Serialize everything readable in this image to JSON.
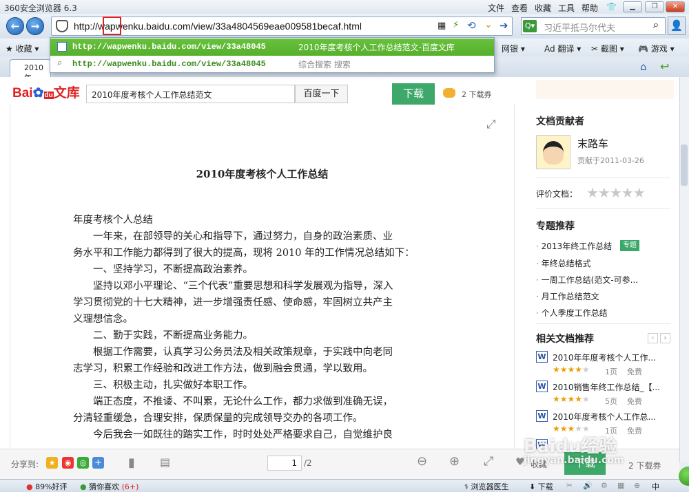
{
  "browser": {
    "title": "360安全浏览器 6.3",
    "menu": [
      "文件",
      "查看",
      "收藏",
      "工具",
      "帮助"
    ],
    "address": "http://wapwenku.baidu.com/view/33a4804569eae009581becaf.html",
    "search_placeholder": "习近平抵马尔代夫",
    "bookmarks": [
      "收藏",
      "网银",
      "翻译",
      "截图",
      "游戏"
    ],
    "tab_label": "2010年"
  },
  "dropdown": {
    "rows": [
      {
        "url": "http://wapwenku.baidu.com/view/33a48045",
        "title": "2010年度考核个人工作总结范文-百度文库"
      },
      {
        "url": "http://wapwenku.baidu.com/view/33a48045",
        "title": "综合搜索 搜索"
      }
    ]
  },
  "baidu": {
    "logo_text": "Bai",
    "logo_du": "du",
    "logo_wenku": "文库",
    "search_value": "2010年度考核个人工作总结范文",
    "search_button": "百度一下",
    "download_button": "下载",
    "coupon": "2 下载券"
  },
  "doc": {
    "title": "2010年度考核个人工作总结",
    "lines": [
      "年度考核个人总结",
      "　　一年来，在部领导的关心和指导下，通过努力，自身的政治素质、业",
      "务水平和工作能力都得到了很大的提高，现将 2010 年的工作情况总结如下：",
      "　　一、坚持学习，不断提高政治素养。",
      "　　坚持以邓小平理论、“三个代表”重要思想和科学发展观为指导，深入",
      "学习贯彻党的十七大精神，进一步增强责任感、使命感，牢固树立共产主",
      "义理想信念。",
      "　　二、勤于实践，不断提高业务能力。",
      "　　根据工作需要，认真学习公务员法及相关政策规章，于实践中向老同",
      "志学习，积累工作经验和改进工作方法，做到融会贯通，学以致用。",
      "　　三、积极主动，扎实做好本职工作。",
      "　　端正态度，不推诿、不叫累，无论什么工作，都力求做到准确无误，",
      "分清轻重缓急，合理安排，保质保量的完成领导交办的各项工作。",
      "　　今后我会一如既往的踏实工作，时时处处严格要求自己，自觉维护良"
    ]
  },
  "sidebar": {
    "contributor_heading": "文档贡献者",
    "contributor_name": "末路车",
    "contributor_date": "贡献于2011-03-26",
    "rating_label": "评价文档：",
    "topic_heading": "专题推荐",
    "topic_tag": "专题",
    "topics": [
      "2013年终工作总结",
      "年终总结格式",
      "一周工作总结(范文-可参...",
      "月工作总结范文",
      "个人季度工作总结"
    ],
    "related_heading": "相关文档推荐",
    "related": [
      {
        "title": "2010年年度考核个人工作...",
        "pages": "1页",
        "price": "免费",
        "stars": 4
      },
      {
        "title": "2010销售年终工作总结_【...",
        "pages": "5页",
        "price": "免费",
        "stars": 4
      },
      {
        "title": "2010年度考核个人工作总...",
        "pages": "1页",
        "price": "免费",
        "stars": 3
      }
    ]
  },
  "bottom": {
    "share_label": "分享到:",
    "page_current": "1",
    "page_total": "/2",
    "favorite": "收藏",
    "download": "下载",
    "coupon": "2 下载券"
  },
  "status": {
    "rating": "89%好评",
    "guess": "猜你喜欢",
    "guess_count": "(6+)",
    "doctor": "浏览器医生",
    "download": "下载",
    "ime": "中"
  },
  "watermark": "Baidu经验",
  "watermark_url": "jingyan.baidu.com"
}
